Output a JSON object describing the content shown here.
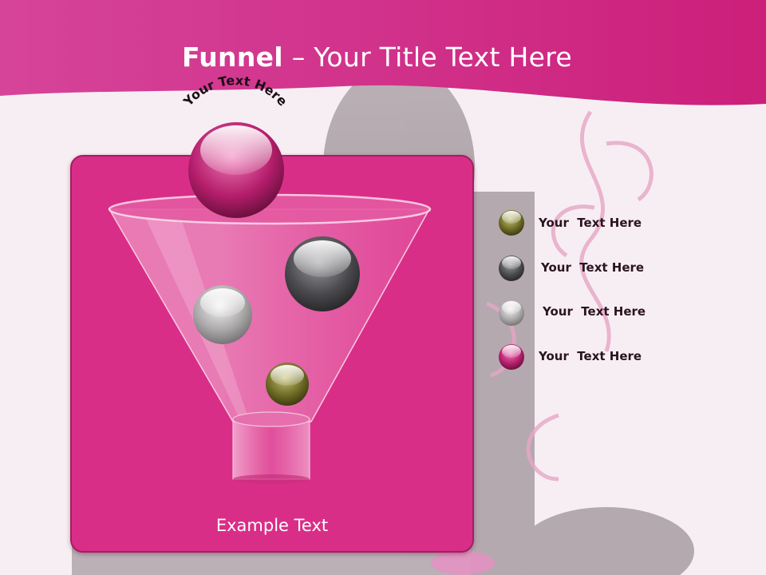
{
  "slide": {
    "title_bold": "Funnel",
    "title_rest": " – Your Title Text Here",
    "arc_text": "Your Text Here",
    "example_text": "Example Text"
  },
  "colors": {
    "header": "#d8338c",
    "panel": "#d92e88",
    "olive": "#6d6a24",
    "dark_gray": "#4a4a4e",
    "light_gray": "#a9a7a8",
    "magenta": "#b51e6c"
  },
  "legend": [
    {
      "label": "Your  Text Here",
      "ball": "olive"
    },
    {
      "label": "Your  Text Here",
      "ball": "dark-gray"
    },
    {
      "label": "Your  Text Here",
      "ball": "light-gray"
    },
    {
      "label": "Your  Text Here",
      "ball": "magenta"
    }
  ]
}
